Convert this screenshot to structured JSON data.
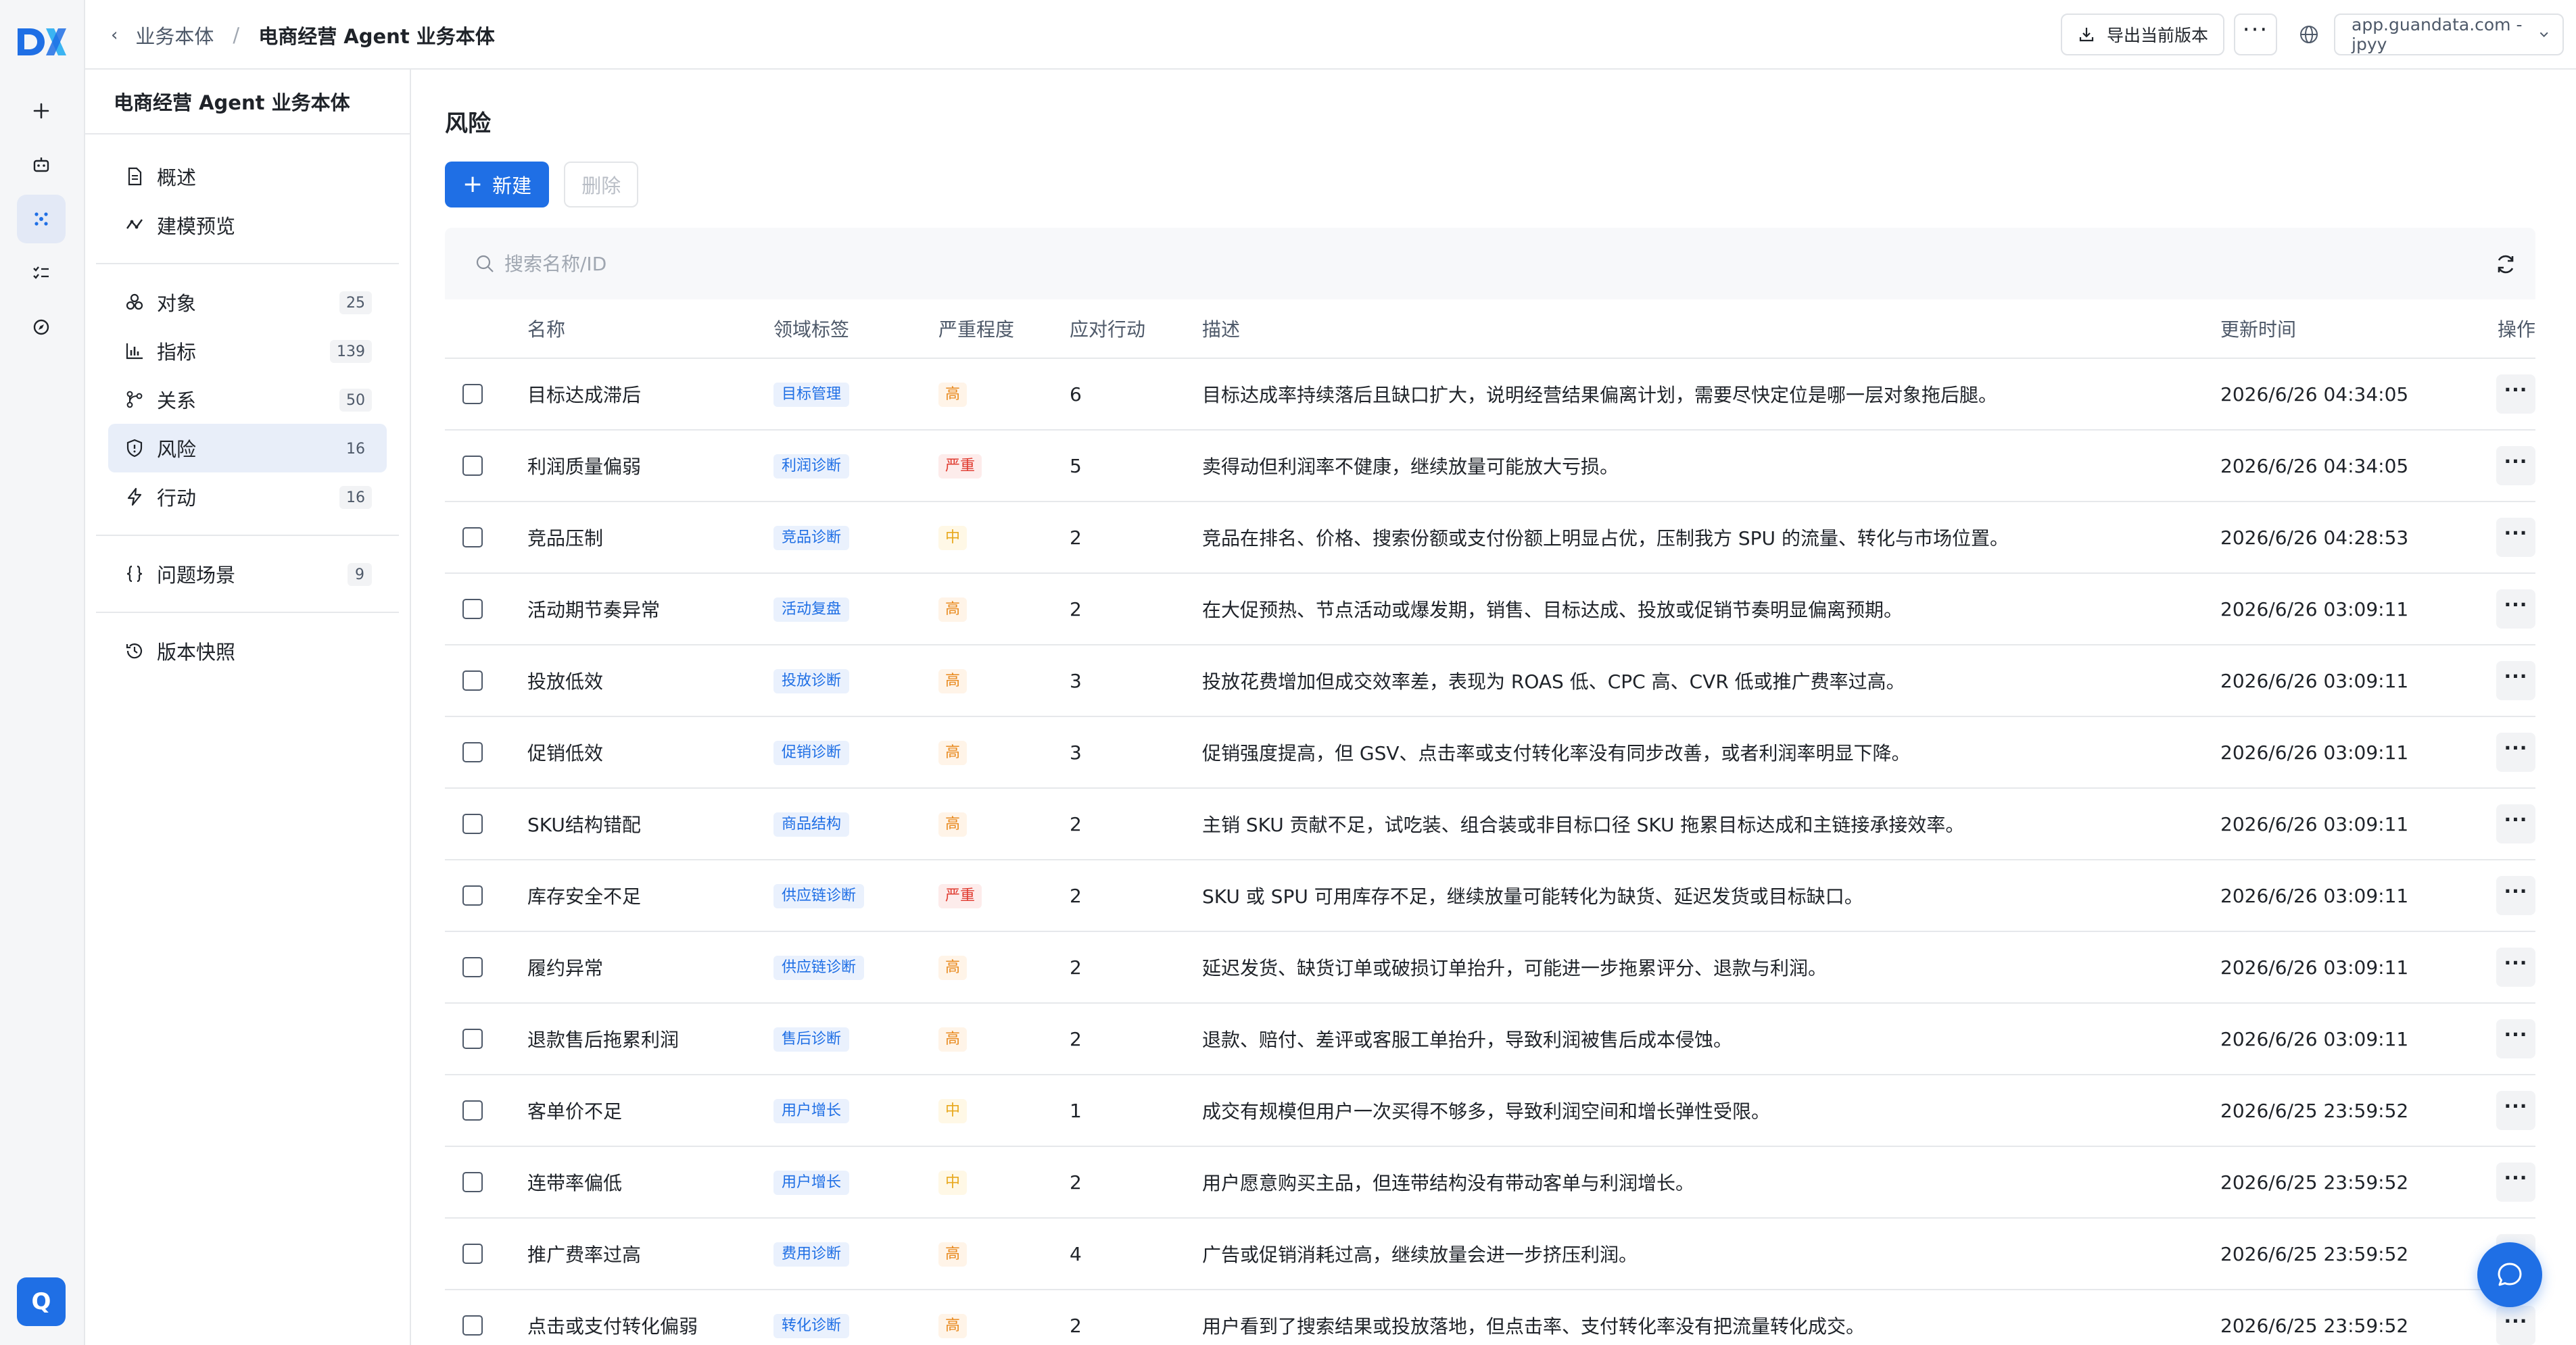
{
  "nav": {
    "rail": [
      "add-icon",
      "robot-icon",
      "ontology-icon",
      "tasks-icon",
      "compass-icon"
    ],
    "user_initial": "Q"
  },
  "topbar": {
    "back_glyph": "‹",
    "breadcrumb_parent": "业务本体",
    "breadcrumb_sep": "/",
    "breadcrumb_current": "电商经营 Agent 业务本体",
    "export_label": "导出当前版本",
    "more_label": "···",
    "domain_value": "app.guandata.com - jpyy"
  },
  "sidebar": {
    "title": "电商经营 Agent 业务本体",
    "items": [
      {
        "label": "概述",
        "icon": "document-icon"
      },
      {
        "label": "建模预览",
        "icon": "model-preview-icon"
      },
      {
        "label": "对象",
        "icon": "objects-icon",
        "count": "25"
      },
      {
        "label": "指标",
        "icon": "metrics-icon",
        "count": "139"
      },
      {
        "label": "关系",
        "icon": "relation-icon",
        "count": "50"
      },
      {
        "label": "风险",
        "icon": "shield-icon",
        "count": "16",
        "active": true
      },
      {
        "label": "行动",
        "icon": "lightning-icon",
        "count": "16"
      },
      {
        "label": "问题场景",
        "icon": "braces-icon",
        "count": "9"
      },
      {
        "label": "版本快照",
        "icon": "history-icon"
      }
    ]
  },
  "main": {
    "title": "风险",
    "new_label": "新建",
    "delete_label": "删除",
    "search_placeholder": "搜索名称/ID"
  },
  "table": {
    "columns": [
      "名称",
      "领域标签",
      "严重程度",
      "应对行动",
      "描述",
      "更新时间",
      "操作"
    ],
    "rows": [
      {
        "name": "目标达成滞后",
        "tag": "目标管理",
        "severity": "高",
        "actions": "6",
        "desc": "目标达成率持续落后且缺口扩大，说明经营结果偏离计划，需要尽快定位是哪一层对象拖后腿。",
        "time": "2026/6/26 04:34:05"
      },
      {
        "name": "利润质量偏弱",
        "tag": "利润诊断",
        "severity": "严重",
        "actions": "5",
        "desc": "卖得动但利润率不健康，继续放量可能放大亏损。",
        "time": "2026/6/26 04:34:05"
      },
      {
        "name": "竞品压制",
        "tag": "竞品诊断",
        "severity": "中",
        "actions": "2",
        "desc": "竞品在排名、价格、搜索份额或支付份额上明显占优，压制我方 SPU 的流量、转化与市场位置。",
        "time": "2026/6/26 04:28:53"
      },
      {
        "name": "活动期节奏异常",
        "tag": "活动复盘",
        "severity": "高",
        "actions": "2",
        "desc": "在大促预热、节点活动或爆发期，销售、目标达成、投放或促销节奏明显偏离预期。",
        "time": "2026/6/26 03:09:11"
      },
      {
        "name": "投放低效",
        "tag": "投放诊断",
        "severity": "高",
        "actions": "3",
        "desc": "投放花费增加但成交效率差，表现为 ROAS 低、CPC 高、CVR 低或推广费率过高。",
        "time": "2026/6/26 03:09:11"
      },
      {
        "name": "促销低效",
        "tag": "促销诊断",
        "severity": "高",
        "actions": "3",
        "desc": "促销强度提高，但 GSV、点击率或支付转化率没有同步改善，或者利润率明显下降。",
        "time": "2026/6/26 03:09:11"
      },
      {
        "name": "SKU结构错配",
        "tag": "商品结构",
        "severity": "高",
        "actions": "2",
        "desc": "主销 SKU 贡献不足，试吃装、组合装或非目标口径 SKU 拖累目标达成和主链接承接效率。",
        "time": "2026/6/26 03:09:11"
      },
      {
        "name": "库存安全不足",
        "tag": "供应链诊断",
        "severity": "严重",
        "actions": "2",
        "desc": "SKU 或 SPU 可用库存不足，继续放量可能转化为缺货、延迟发货或目标缺口。",
        "time": "2026/6/26 03:09:11"
      },
      {
        "name": "履约异常",
        "tag": "供应链诊断",
        "severity": "高",
        "actions": "2",
        "desc": "延迟发货、缺货订单或破损订单抬升，可能进一步拖累评分、退款与利润。",
        "time": "2026/6/26 03:09:11"
      },
      {
        "name": "退款售后拖累利润",
        "tag": "售后诊断",
        "severity": "高",
        "actions": "2",
        "desc": "退款、赔付、差评或客服工单抬升，导致利润被售后成本侵蚀。",
        "time": "2026/6/26 03:09:11"
      },
      {
        "name": "客单价不足",
        "tag": "用户增长",
        "severity": "中",
        "actions": "1",
        "desc": "成交有规模但用户一次买得不够多，导致利润空间和增长弹性受限。",
        "time": "2026/6/25 23:59:52"
      },
      {
        "name": "连带率偏低",
        "tag": "用户增长",
        "severity": "中",
        "actions": "2",
        "desc": "用户愿意购买主品，但连带结构没有带动客单与利润增长。",
        "time": "2026/6/25 23:59:52"
      },
      {
        "name": "推广费率过高",
        "tag": "费用诊断",
        "severity": "高",
        "actions": "4",
        "desc": "广告或促销消耗过高，继续放量会进一步挤压利润。",
        "time": "2026/6/25 23:59:52"
      },
      {
        "name": "点击或支付转化偏弱",
        "tag": "转化诊断",
        "severity": "高",
        "actions": "2",
        "desc": "用户看到了搜索结果或投放落地，但点击率、支付转化率没有把流量转化成交。",
        "time": "2026/6/25 23:59:52"
      }
    ]
  },
  "colors": {
    "accent": "#1f6fe5",
    "severity_high": "#e8891d",
    "severity_critical": "#e03b30",
    "severity_medium": "#e8a81d"
  }
}
